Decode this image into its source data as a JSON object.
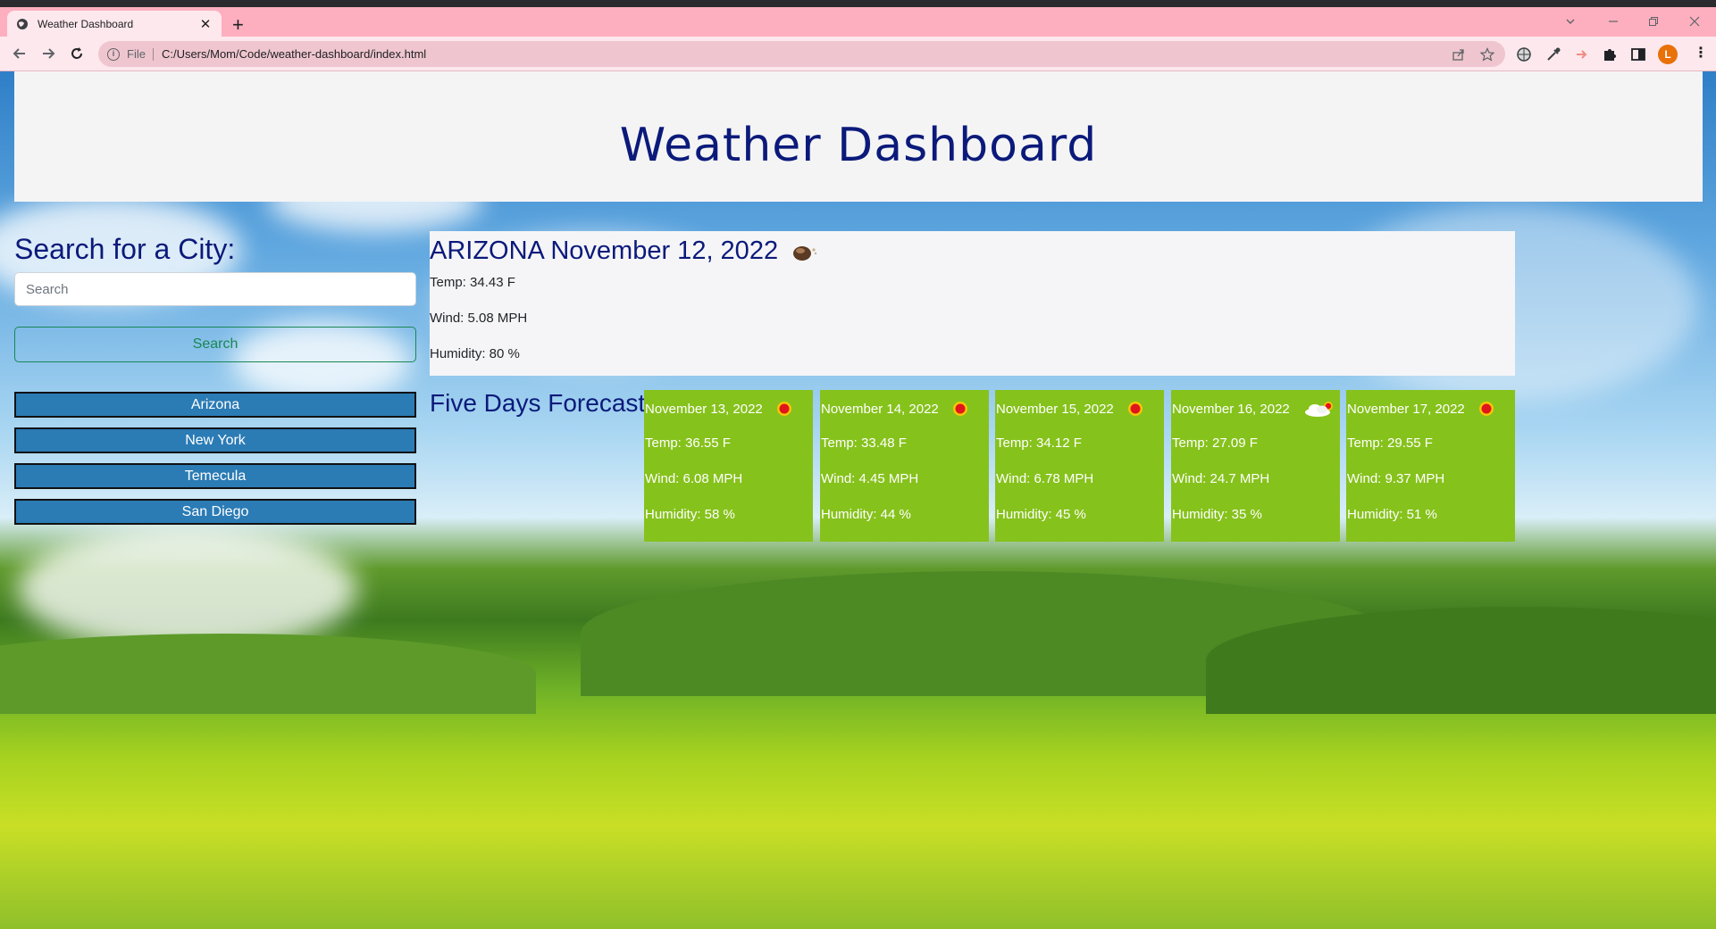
{
  "browser": {
    "tab_title": "Weather Dashboard",
    "close_glyph": "✕",
    "new_tab_glyph": "+",
    "scheme_label": "File",
    "url": "C:/Users/Mom/Code/weather-dashboard/index.html",
    "profile_initial": "L"
  },
  "header": {
    "title": "Weather Dashboard"
  },
  "sidebar": {
    "heading": "Search for a City:",
    "search_placeholder": "Search",
    "search_button": "Search",
    "cities": [
      "Arizona",
      "New York",
      "Temecula",
      "San Diego"
    ]
  },
  "current": {
    "title": "ARIZONA November 12, 2022",
    "icon": "haze-icon",
    "temp": "Temp: 34.43 F",
    "wind": "Wind: 5.08 MPH",
    "humidity": "Humidity: 80 %"
  },
  "forecast": {
    "heading": "Five Days Forecast",
    "days": [
      {
        "date": "November 13, 2022",
        "icon": "sun-icon",
        "temp": "Temp: 36.55 F",
        "wind": "Wind: 6.08 MPH",
        "humidity": "Humidity: 58 %"
      },
      {
        "date": "November 14, 2022",
        "icon": "sun-icon",
        "temp": "Temp: 33.48 F",
        "wind": "Wind: 4.45 MPH",
        "humidity": "Humidity: 44 %"
      },
      {
        "date": "November 15, 2022",
        "icon": "sun-icon",
        "temp": "Temp: 34.12 F",
        "wind": "Wind: 6.78 MPH",
        "humidity": "Humidity: 45 %"
      },
      {
        "date": "November 16, 2022",
        "icon": "cloud-sun-icon",
        "temp": "Temp: 27.09 F",
        "wind": "Wind: 24.7 MPH",
        "humidity": "Humidity: 35 %"
      },
      {
        "date": "November 17, 2022",
        "icon": "sun-icon",
        "temp": "Temp: 29.55 F",
        "wind": "Wind: 9.37 MPH",
        "humidity": "Humidity: 51 %"
      }
    ]
  },
  "colors": {
    "tab_bar": "#fdafbf",
    "heading": "#0b1a7a",
    "city_button": "#2b7bb5",
    "forecast_card": "#86c21c",
    "search_button": "#198754"
  }
}
